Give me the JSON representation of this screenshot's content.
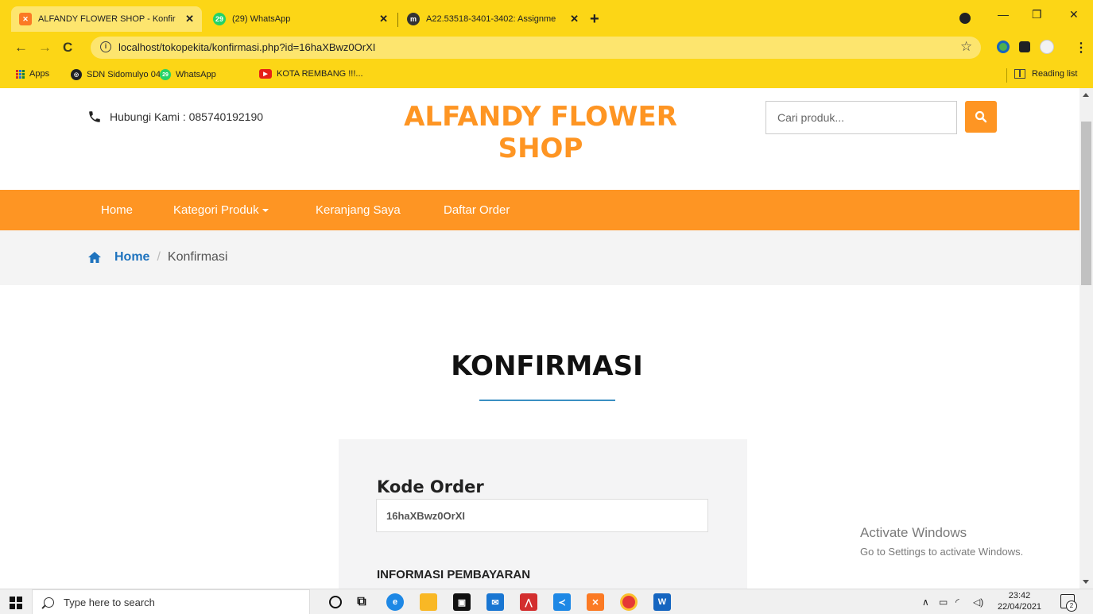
{
  "browser": {
    "tabs": [
      {
        "title": "ALFANDY FLOWER SHOP - Konfir",
        "favicon": "xampp-icon",
        "active": true
      },
      {
        "title": "(29) WhatsApp",
        "favicon": "whatsapp-icon",
        "badge": "29",
        "active": false
      },
      {
        "title": "A22.53518-3401-3402: Assignme",
        "favicon": "moodle-icon",
        "active": false
      }
    ],
    "url": "localhost/tokopekita/konfirmasi.php?id=16haXBwz0OrXI",
    "bookmarks": [
      {
        "label": "Apps",
        "icon": "apps-grid-icon"
      },
      {
        "label": "SDN Sidomulyo 04",
        "icon": "globe-icon"
      },
      {
        "label": "WhatsApp",
        "icon": "whatsapp-icon",
        "badge": "29"
      },
      {
        "label": "KOTA REMBANG !!!...",
        "icon": "youtube-icon"
      }
    ],
    "reading_list": "Reading list",
    "chrome_color": "#fcd616"
  },
  "header": {
    "contact": "Hubungi Kami : 085740192190",
    "brand": "ALFANDY FLOWER SHOP",
    "search_placeholder": "Cari produk...",
    "brand_color": "#fe9523"
  },
  "nav": {
    "items": [
      "Home",
      "Kategori Produk",
      "Keranjang Saya",
      "Daftar Order"
    ]
  },
  "breadcrumb": {
    "home": "Home",
    "separator": "/",
    "current": "Konfirmasi"
  },
  "main": {
    "title": "KONFIRMASI",
    "order_code_label": "Kode Order",
    "order_code_value": "16haXBwz0OrXI",
    "payment_info_label": "INFORMASI PEMBAYARAN"
  },
  "watermark": {
    "line1": "Activate Windows",
    "line2": "Go to Settings to activate Windows."
  },
  "taskbar": {
    "search_placeholder": "Type here to search",
    "time": "23:42",
    "date": "22/04/2021",
    "notifications": "2"
  }
}
